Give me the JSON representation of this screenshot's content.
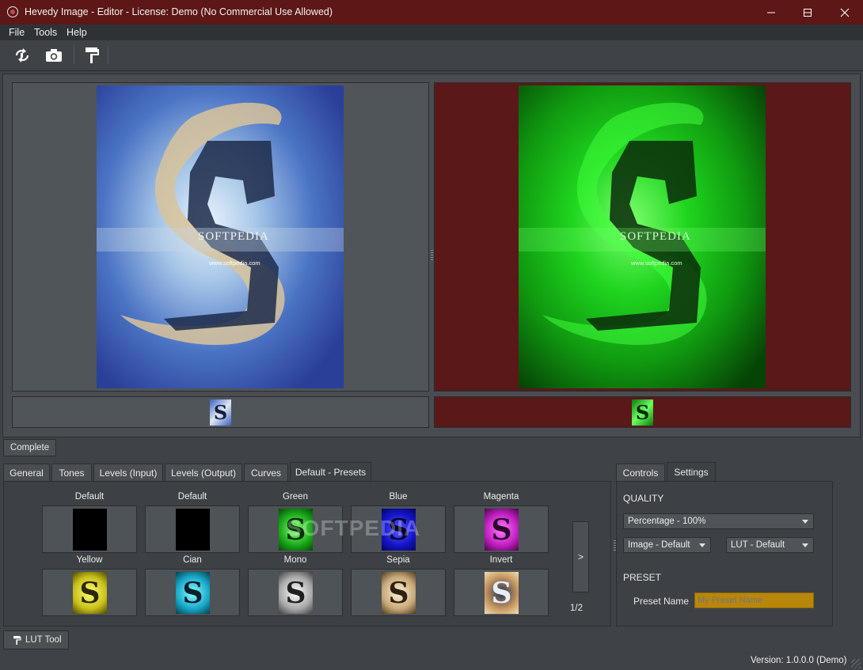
{
  "window": {
    "title": "Hevedy Image - Editor - License: Demo (No Commercial Use Allowed)",
    "controls": [
      "minimize-icon",
      "maximize-icon",
      "close-icon"
    ]
  },
  "menu": {
    "file": "File",
    "tools": "Tools",
    "help": "Help"
  },
  "toolbar": {
    "icons": [
      "refresh-swap-icon",
      "camera-icon",
      "paint-roller-icon"
    ]
  },
  "viewer": {
    "watermark": "SOFTPEDIA",
    "url": "www.softpedia.com",
    "right_panel_color": "#5a1818"
  },
  "bottom": {
    "complete_label": "Complete",
    "tabs": [
      "General",
      "Tones",
      "Levels (Input)",
      "Levels (Output)",
      "Curves",
      "Default - Presets"
    ],
    "active_tab": "Default - Presets",
    "presets": [
      {
        "label": "Default",
        "swatch": "black"
      },
      {
        "label": "Default",
        "swatch": "black"
      },
      {
        "label": "Green",
        "swatch": "green"
      },
      {
        "label": "Blue",
        "swatch": "blue"
      },
      {
        "label": "Magenta",
        "swatch": "magenta"
      },
      {
        "label": "Yellow",
        "swatch": "yellow"
      },
      {
        "label": "Cian",
        "swatch": "cyan"
      },
      {
        "label": "Mono",
        "swatch": "mono"
      },
      {
        "label": "Sepia",
        "swatch": "sepia"
      },
      {
        "label": "Invert",
        "swatch": "invert"
      }
    ],
    "next_label": ">",
    "page": "1/2",
    "watermark": "SOFTPEDIA"
  },
  "settings": {
    "tabs": [
      "Controls",
      "Settings"
    ],
    "active_tab": "Settings",
    "quality_heading": "QUALITY",
    "quality_value": "Percentage - 100%",
    "image_value": "Image - Default",
    "lut_value": "LUT - Default",
    "preset_heading": "PRESET",
    "preset_name_label": "Preset Name",
    "preset_name_placeholder": "My Preset Name"
  },
  "footer": {
    "lut_tool_label": "LUT Tool",
    "version": "Version: 1.0.0.0 (Demo)"
  },
  "colors": {
    "titlebar": "#5c1716",
    "accent_input": "#b8860b"
  }
}
